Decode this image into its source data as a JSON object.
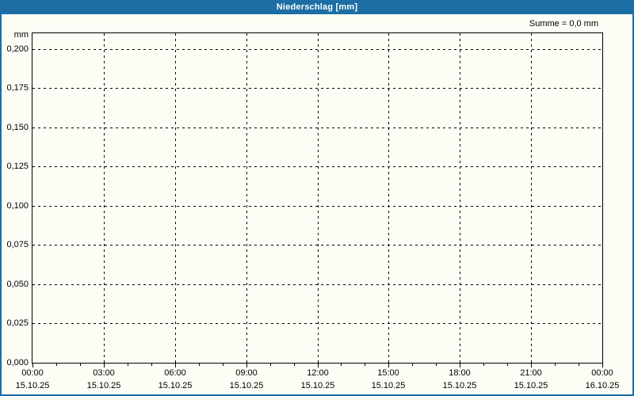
{
  "window": {
    "title": "Niederschlag [mm]"
  },
  "summary": {
    "text": "Summe = 0,0 mm"
  },
  "y_axis": {
    "unit": "mm"
  },
  "colors": {
    "accent_blue": "#1c6ea4",
    "background": "#fdfdf6",
    "grid_and_text": "#000000",
    "title_text": "#ffffff"
  },
  "chart_data": {
    "type": "line",
    "title": "Niederschlag [mm]",
    "ylabel": "mm",
    "sum_annotation": "Summe = 0,0 mm",
    "grid": "dashed",
    "legend": "none",
    "ylim": [
      0,
      0.21
    ],
    "xlim_hours": [
      0,
      24
    ],
    "minor_tick_interval_hours": 1,
    "major_tick_interval_hours": 3,
    "y_ticks": [
      {
        "value": 0.2,
        "label": "0,200"
      },
      {
        "value": 0.175,
        "label": "0,175"
      },
      {
        "value": 0.15,
        "label": "0,150"
      },
      {
        "value": 0.125,
        "label": "0,125"
      },
      {
        "value": 0.1,
        "label": "0,100"
      },
      {
        "value": 0.075,
        "label": "0,075"
      },
      {
        "value": 0.05,
        "label": "0,050"
      },
      {
        "value": 0.025,
        "label": "0,025"
      },
      {
        "value": 0.0,
        "label": "0,000"
      }
    ],
    "x_ticks": [
      {
        "hour": 0,
        "time": "00:00",
        "date": "15.10.25"
      },
      {
        "hour": 3,
        "time": "03:00",
        "date": "15.10.25"
      },
      {
        "hour": 6,
        "time": "06:00",
        "date": "15.10.25"
      },
      {
        "hour": 9,
        "time": "09:00",
        "date": "15.10.25"
      },
      {
        "hour": 12,
        "time": "12:00",
        "date": "15.10.25"
      },
      {
        "hour": 15,
        "time": "15:00",
        "date": "15.10.25"
      },
      {
        "hour": 18,
        "time": "18:00",
        "date": "15.10.25"
      },
      {
        "hour": 21,
        "time": "21:00",
        "date": "15.10.25"
      },
      {
        "hour": 24,
        "time": "00:00",
        "date": "16.10.25"
      }
    ],
    "series": [
      {
        "name": "Niederschlag",
        "points": []
      }
    ]
  }
}
